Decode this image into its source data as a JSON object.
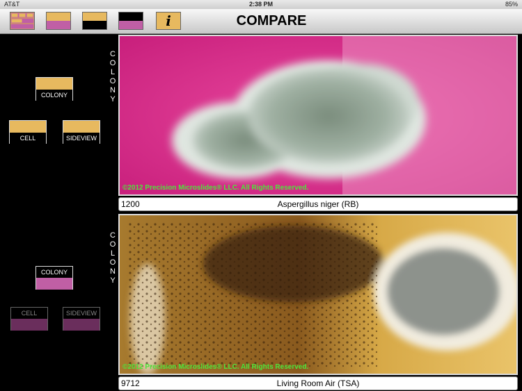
{
  "status": {
    "carrier": "AT&T",
    "time": "2:38 PM",
    "battery": "85%"
  },
  "toolbar": {
    "title": "COMPARE",
    "info_label": "i",
    "buttons": [
      {
        "name": "grid-view-button",
        "icon": "grid-icon"
      },
      {
        "name": "compare-tan-magenta-button",
        "icon": "tan-magenta-swatch-icon"
      },
      {
        "name": "compare-tan-black-button",
        "icon": "tan-black-swatch-icon"
      },
      {
        "name": "compare-black-magenta-button",
        "icon": "black-magenta-swatch-icon"
      }
    ]
  },
  "top_panel": {
    "vertical_label": "COLONY",
    "buttons": {
      "colony": "COLONY",
      "cell": "CELL",
      "sideview": "SIDEVIEW"
    },
    "copyright": "©2012 Precision Microslides® LLC.  All Rights Reserved.",
    "caption_number": "1200",
    "caption_name": "Aspergillus niger (RB)"
  },
  "bottom_panel": {
    "vertical_label": "COLONY",
    "buttons": {
      "colony": "COLONY",
      "cell": "CELL",
      "sideview": "SIDEVIEW"
    },
    "copyright": "©2012 Precision Microslides® LLC.  All Rights Reserved.",
    "caption_number": "9712",
    "caption_name": "Living Room Air (TSA)"
  },
  "colors": {
    "tan": "#e7b95f",
    "magenta": "#c05fa5",
    "pink_agar": "#e0308f",
    "copyright_green": "#4ce63a"
  }
}
